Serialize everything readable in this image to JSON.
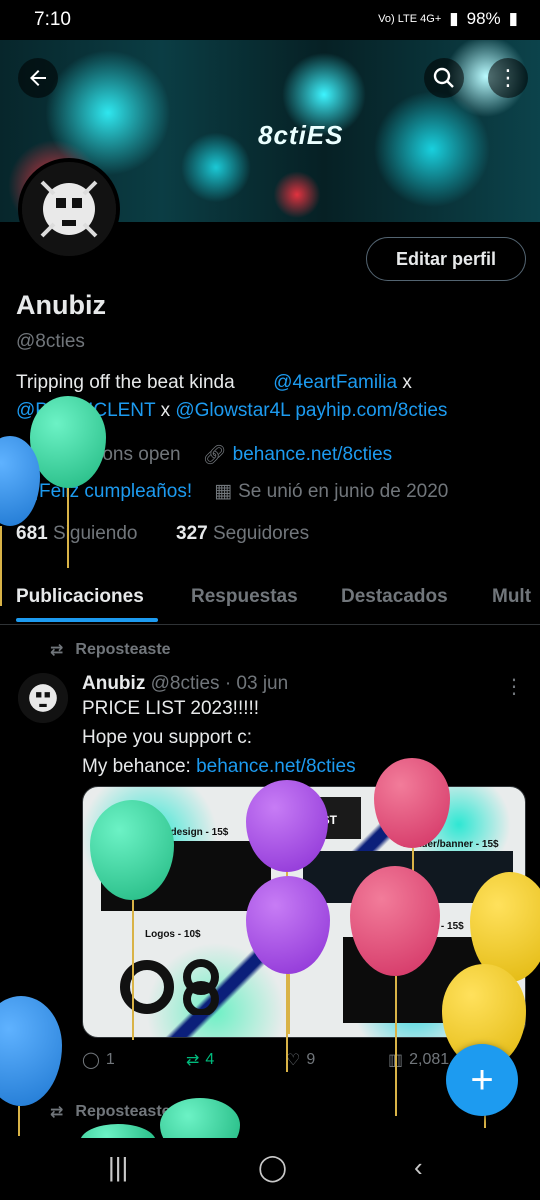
{
  "status_bar": {
    "time": "7:10",
    "network": "Vo) LTE 4G+",
    "battery": "98%"
  },
  "banner": {
    "logo_text": "8ctiES"
  },
  "profile": {
    "edit_button": "Editar perfil",
    "display_name": "Anubiz",
    "handle": "@8cties",
    "bio_line1_text": "Tripping off the beat kinda",
    "bio_line1_mention": "@4eartFamilia",
    "bio_line1_suffix": "x",
    "bio_line2_mention1": "@PROFICLENT",
    "bio_line2_x": "x",
    "bio_line2_mention2": "@Glowstar4L",
    "bio_line2_link": "payhip.com/8cties",
    "location": "commisions open",
    "website": "behance.net/8cties",
    "birthday": "¡Feliz cumpleaños!",
    "joined": "Se unió en junio de 2020",
    "following_count": "681",
    "following_label": "Siguiendo",
    "followers_count": "327",
    "followers_label": "Seguidores"
  },
  "tabs": [
    "Publicaciones",
    "Respuestas",
    "Destacados",
    "Mult"
  ],
  "tweet": {
    "repost_label": "Reposteaste",
    "name": "Anubiz",
    "handle": "@8cties",
    "date": "· 03 jun",
    "line1": "PRICE LIST 2023!!!!!",
    "line2": "Hope you support c:",
    "line3_prefix": "My behance:",
    "line3_link": "behance.net/8cties",
    "image_labels": {
      "price_list": "PRICE LIST",
      "shirt": "Shirt design - 15$",
      "header": "Header/banner - 15$",
      "logos": "Logos - 10$",
      "poster": "Poster - 15$"
    },
    "replies": "1",
    "reposts": "4",
    "likes": "9",
    "views": "2,081"
  },
  "next_repost_label": "Reposteaste",
  "colors": {
    "accent": "#1d9bf0",
    "repost_green": "#00ba7c",
    "muted": "#71767b"
  }
}
